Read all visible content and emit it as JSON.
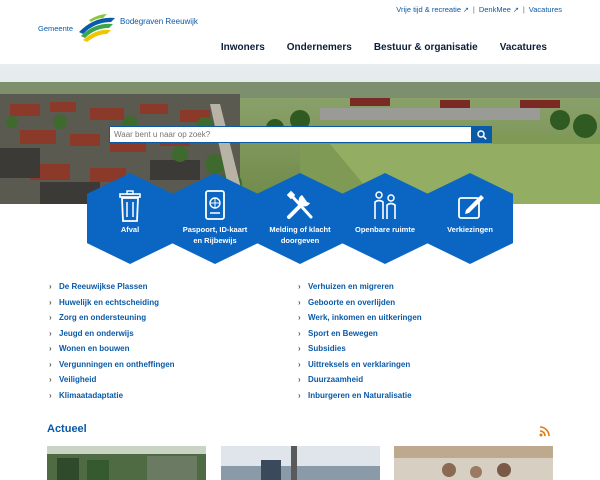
{
  "header": {
    "logo_prefix": "Gemeente",
    "logo_name": "Bodegraven Reeuwijk",
    "top_links": [
      "Vrije tijd & recreatie",
      "DenkMee",
      "Vacatures"
    ],
    "nav": [
      "Inwoners",
      "Ondernemers",
      "Bestuur & organisatie",
      "Vacatures"
    ]
  },
  "search": {
    "placeholder": "Waar bent u naar op zoek?"
  },
  "tasks": [
    {
      "label": "Afval",
      "icon": "trash-icon"
    },
    {
      "label": "Paspoort, ID-kaart en Rijbewijs",
      "icon": "passport-icon"
    },
    {
      "label": "Melding of klacht doorgeven",
      "icon": "tools-icon"
    },
    {
      "label": "Openbare ruimte",
      "icon": "people-icon"
    },
    {
      "label": "Verkiezingen",
      "icon": "ballot-icon"
    }
  ],
  "links_left": [
    "De Reeuwijkse Plassen",
    "Huwelijk en echtscheiding",
    "Zorg en ondersteuning",
    "Jeugd en onderwijs",
    "Wonen en bouwen",
    "Vergunningen en ontheffingen",
    "Veiligheid",
    "Klimaatadaptatie"
  ],
  "links_right": [
    "Verhuizen en migreren",
    "Geboorte en overlijden",
    "Werk, inkomen en uitkeringen",
    "Sport en Bewegen",
    "Subsidies",
    "Uittreksels en verklaringen",
    "Duurzaamheid",
    "Inburgeren en Naturalisatie"
  ],
  "actueel": {
    "title": "Actueel"
  },
  "colors": {
    "brand_blue": "#0a66c2",
    "link_blue": "#0a5aa8",
    "nav_dark": "#0b1f3a"
  }
}
